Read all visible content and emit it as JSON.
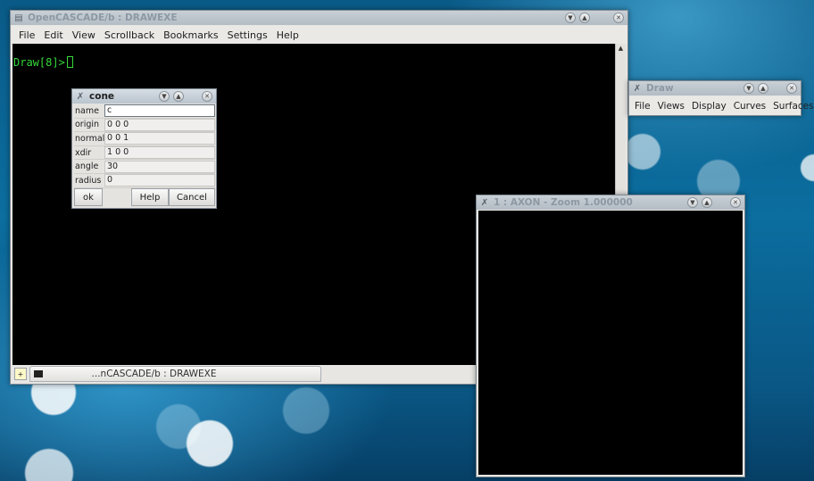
{
  "terminal": {
    "title": "OpenCASCADE/b : DRAWEXE",
    "menu": [
      "File",
      "Edit",
      "View",
      "Scrollback",
      "Bookmarks",
      "Settings",
      "Help"
    ],
    "prompt": "Draw[8]>",
    "tab_label": "...nCASCADE/b : DRAWEXE"
  },
  "cone_dialog": {
    "title": "cone",
    "fields": [
      {
        "label": "name",
        "value": "c"
      },
      {
        "label": "origin",
        "value": "0 0 0"
      },
      {
        "label": "normal",
        "value": "0 0 1"
      },
      {
        "label": "xdir",
        "value": "1 0 0"
      },
      {
        "label": "angle",
        "value": "30"
      },
      {
        "label": "radius",
        "value": "0"
      }
    ],
    "buttons": {
      "ok": "ok",
      "help": "Help",
      "cancel": "Cancel"
    }
  },
  "draw_window": {
    "title": "Draw",
    "menu": [
      "File",
      "Views",
      "Display",
      "Curves",
      "Surfaces"
    ]
  },
  "axon_window": {
    "title": "1 : AXON - Zoom 1.000000"
  },
  "icons": {
    "app": "terminal-icon",
    "minimize": "chevron-down-icon",
    "maximize": "chevron-up-icon",
    "close": "close-icon"
  }
}
